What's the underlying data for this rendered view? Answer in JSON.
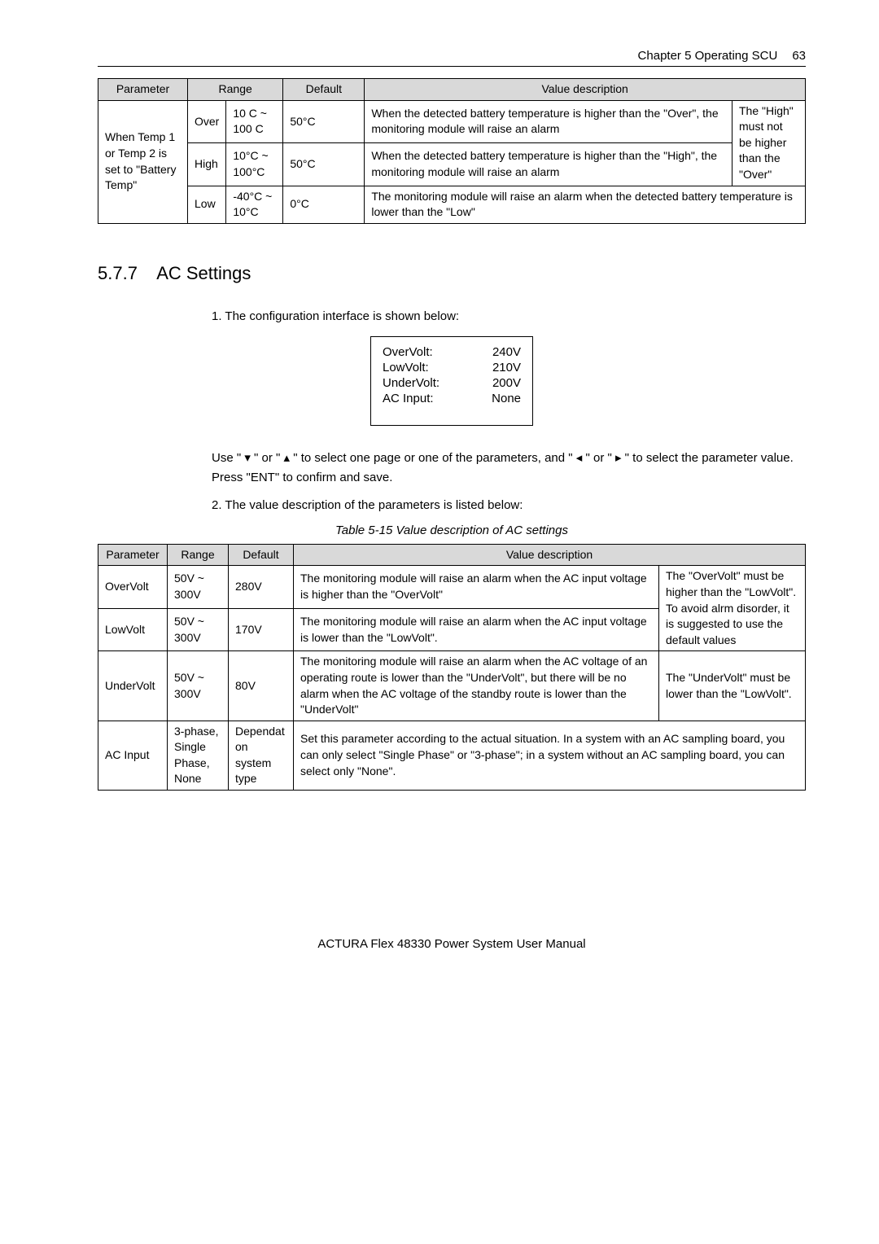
{
  "header": {
    "chapter": "Chapter  5    Operating  SCU",
    "page": "63"
  },
  "table1": {
    "h1": "Parameter",
    "h2": "Range",
    "h3": "Default",
    "h4": "Value description",
    "param": "When Temp 1 or Temp 2 is set to \"Battery Temp\"",
    "r1_range1": "Over",
    "r1_range2": "10 C ~ 100 C",
    "r1_default": "50°C",
    "r1_desc": "When the detected battery temperature is higher than the \"Over\", the monitoring module will raise an alarm",
    "r2_range1": "High",
    "r2_range2": "10°C ~ 100°C",
    "r2_default": "50°C",
    "r2_desc": "When the detected battery temperature is higher than the \"High\", the monitoring module will raise an alarm",
    "r3_range1": "Low",
    "r3_range2": "-40°C ~ 10°C",
    "r3_default": "0°C",
    "r3_desc": "The monitoring module will raise an alarm when the detected battery temperature is lower than the \"Low\"",
    "side_note": "The \"High\" must not be higher than the \"Over\""
  },
  "section": {
    "num": "5.7.7",
    "title": "AC Settings"
  },
  "body": {
    "p1": "1. The configuration interface is shown below:",
    "p2a": "Use \" ",
    "p2b": " \" or \" ",
    "p2c": " \" to select one page or one of the parameters, and \" ",
    "p2d": " \" or \" ",
    "p2e": " \" to select the parameter value. Press \"ENT\" to confirm and save.",
    "p3": "2. The value description of the parameters is listed below:"
  },
  "config": {
    "r1k": "OverVolt:",
    "r1v": "240V",
    "r2k": "LowVolt:",
    "r2v": "210V",
    "r3k": "UnderVolt:",
    "r3v": "200V",
    "r4k": "AC Input:",
    "r4v": "None"
  },
  "caption": "Table 5-15    Value description of AC settings",
  "table2": {
    "h1": "Parameter",
    "h2": "Range",
    "h3": "Default",
    "h4": "Value description",
    "r1_param": "OverVolt",
    "r1_range": "50V ~ 300V",
    "r1_default": "280V",
    "r1_desc": "The monitoring module will raise an alarm when the AC input voltage is higher than the \"OverVolt\"",
    "r2_param": "LowVolt",
    "r2_range": "50V ~ 300V",
    "r2_default": "170V",
    "r2_desc": "The monitoring module will raise an alarm when the AC input voltage is lower than the \"LowVolt\".",
    "side12": "The \"OverVolt\" must be higher than the \"LowVolt\". To avoid alrm disorder, it is suggested to use the default values",
    "r3_param": "UnderVolt",
    "r3_range": "50V ~ 300V",
    "r3_default": "80V",
    "r3_desc": "The monitoring module will raise an alarm when the AC voltage of an operating route is lower than the \"UnderVolt\", but there will be no alarm when the AC voltage of the standby route is lower than the \"UnderVolt\"",
    "r3_side": "The \"UnderVolt\" must be lower than the \"LowVolt\".",
    "r4_param": "AC Input",
    "r4_range": "3-phase, Single Phase, None",
    "r4_default": "Dependat on system type",
    "r4_desc": "Set this parameter according to the actual situation. In a system with an AC sampling board, you can only select \"Single Phase\" or \"3-phase\"; in a system without an AC sampling board, you can select only \"None\"."
  },
  "footer": "ACTURA Flex 48330 Power System    User Manual",
  "arrows": {
    "down": "▾",
    "up": "▴",
    "left": "◂",
    "right": "▸"
  }
}
